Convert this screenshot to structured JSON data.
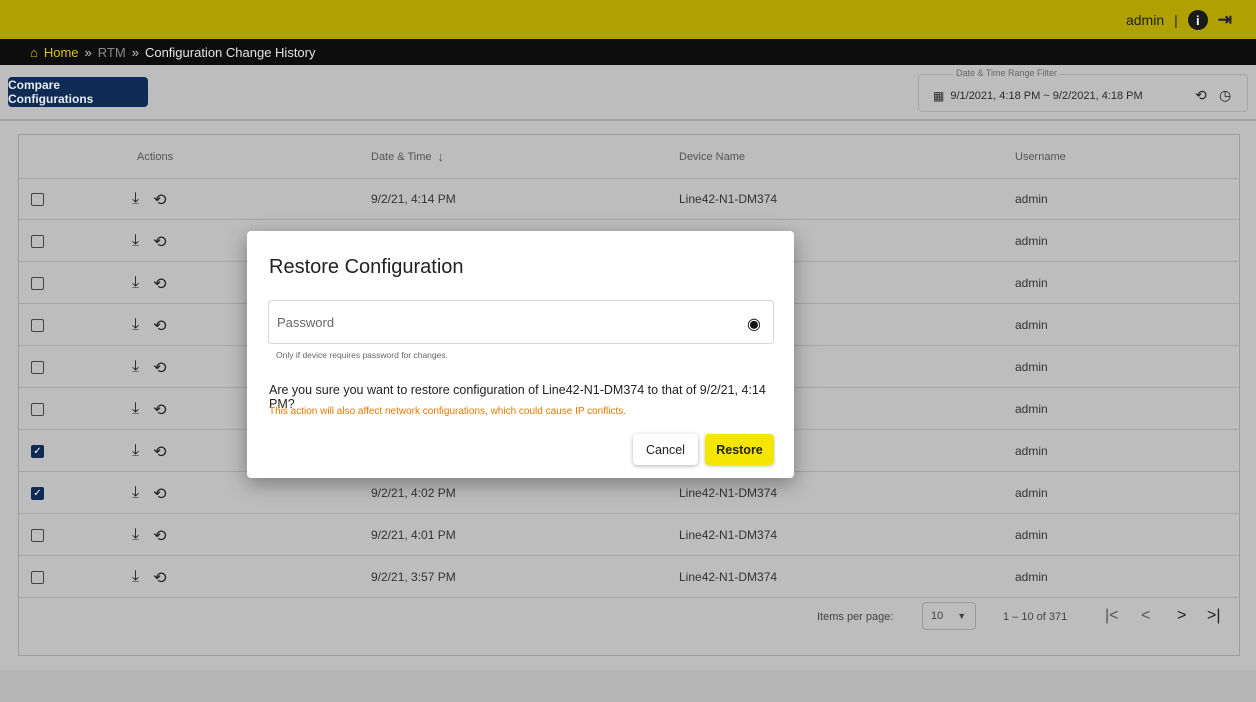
{
  "header": {
    "username": "admin",
    "separator": "|",
    "info_icon": "info-icon",
    "logout_icon": "logout-icon"
  },
  "breadcrumb": {
    "home": "Home",
    "sep1": "»",
    "rtm": "RTM",
    "sep2": "»",
    "current": "Configuration Change History"
  },
  "toolbar": {
    "compare_label": "Compare Configurations",
    "filter_label": "Date & Time Range Filter",
    "filter_value": "9/1/2021, 4:18 PM ~ 9/2/2021, 4:18 PM"
  },
  "table": {
    "headers": {
      "actions": "Actions",
      "datetime": "Date & Time",
      "device": "Device Name",
      "username": "Username"
    },
    "rows": [
      {
        "checked": false,
        "datetime": "9/2/21, 4:14 PM",
        "device": "Line42-N1-DM374",
        "username": "admin"
      },
      {
        "checked": false,
        "datetime": "",
        "device": "",
        "username": "admin"
      },
      {
        "checked": false,
        "datetime": "",
        "device": "",
        "username": "admin"
      },
      {
        "checked": false,
        "datetime": "",
        "device": "",
        "username": "admin"
      },
      {
        "checked": false,
        "datetime": "",
        "device": "",
        "username": "admin"
      },
      {
        "checked": false,
        "datetime": "",
        "device": "",
        "username": "admin"
      },
      {
        "checked": true,
        "datetime": "",
        "device": "",
        "username": "admin"
      },
      {
        "checked": true,
        "datetime": "9/2/21, 4:02 PM",
        "device": "Line42-N1-DM374",
        "username": "admin"
      },
      {
        "checked": false,
        "datetime": "9/2/21, 4:01 PM",
        "device": "Line42-N1-DM374",
        "username": "admin"
      },
      {
        "checked": false,
        "datetime": "9/2/21, 3:57 PM",
        "device": "Line42-N1-DM374",
        "username": "admin"
      }
    ]
  },
  "paginator": {
    "items_per_page_label": "Items per page:",
    "items_per_page": "10",
    "range": "1 – 10 of 371"
  },
  "dialog": {
    "title": "Restore Configuration",
    "password_placeholder": "Password",
    "hint": "Only if device requires password for changes.",
    "confirm_text": "Are you sure you want to restore configuration of Line42-N1-DM374 to that of 9/2/21, 4:14 PM?",
    "warning_text": "This action will also affect network configurations, which could cause IP conflicts.",
    "cancel_label": "Cancel",
    "restore_label": "Restore"
  }
}
